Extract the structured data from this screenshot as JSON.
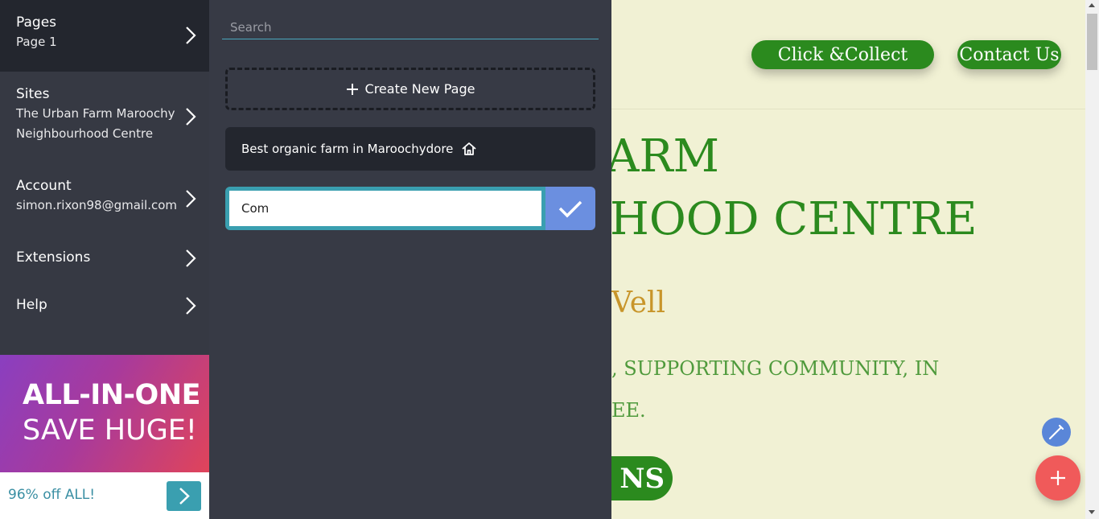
{
  "sidebar": {
    "pages": {
      "title": "Pages",
      "sub": "Page 1"
    },
    "sites": {
      "title": "Sites",
      "sub_line1": "The Urban Farm Maroochy",
      "sub_line2": "Neighbourhood Centre"
    },
    "account": {
      "title": "Account",
      "sub": "simon.rixon98@gmail.com"
    },
    "extensions": {
      "title": "Extensions"
    },
    "help": {
      "title": "Help"
    }
  },
  "promo": {
    "line1": "ALL-IN-ONE",
    "line2": "SAVE HUGE!",
    "offer": "96% off ALL!"
  },
  "panel": {
    "search_placeholder": "Search",
    "create_label": "Create New Page",
    "home_page_label": "Best organic farm in Maroochydore",
    "new_page_value": "Com"
  },
  "site": {
    "button_collect": "Click &Collect",
    "button_contact": "Contact Us",
    "hero_line1": "ARM",
    "hero_line2": "HOOD CENTRE",
    "tagline": "Vell",
    "desc_line1": ", SUPPORTING COMMUNITY, IN",
    "desc_line2": "EE.",
    "cta": "NS"
  },
  "colors": {
    "sidebar_bg": "#363943",
    "panel_bg": "#373a45",
    "accent_teal": "#3a9fb0",
    "confirm_blue": "#6b8fe0",
    "site_bg": "#f1f1d4",
    "brand_green": "#2b8a1e",
    "fab_red": "#f05a5a"
  }
}
